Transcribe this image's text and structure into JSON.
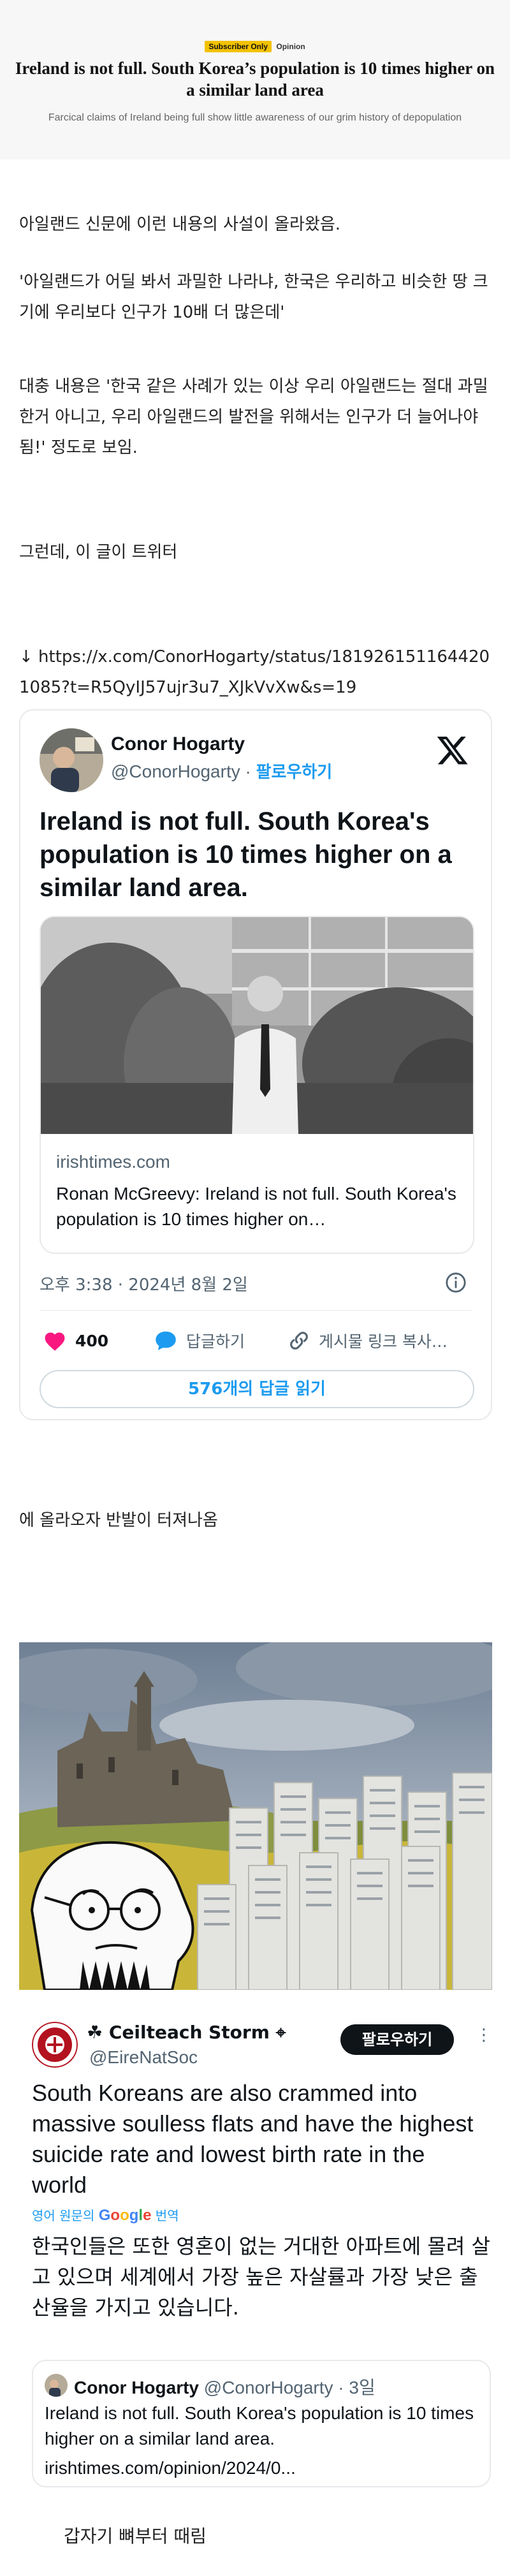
{
  "article": {
    "badge": "Subscriber Only",
    "section": "Opinion",
    "title": "Ireland is not full. South Korea’s population is 10 times higher on a similar land area",
    "subtitle": "Farcical claims of Ireland being full show little awareness of our grim history of depopulation",
    "colors": {
      "badge_bg": "#f2c200",
      "background": "#f7f7f7"
    }
  },
  "body": {
    "p1": "아일랜드 신문에 이런 내용의 사설이 올라왔음.",
    "p2": " '아일랜드가 어딜 봐서 과밀한 나라냐, 한국은 우리하고 비슷한 땅 크기에 우리보다 인구가 10배 더 많은데'",
    "p3": " 대충 내용은 '한국 같은 사례가 있는 이상 우리 아일랜드는 절대 과밀한거 아니고, 우리 아일랜드의 발전을 위해서는 인구가 더 늘어나야 됨!' 정도로 보임.",
    "p4": " 그런데, 이 글이 트위터",
    "url": "↓ https://x.com/ConorHogarty/status/1819261511644201085?t=R5QyIJ57ujr3u7_XJkVvXw&s=19",
    "p5": "에 올라오자 반발이 터져나옴",
    "closing": "갑자기 뼈부터 때림"
  },
  "tweet": {
    "name": "Conor Hogarty",
    "handle": "@ConorHogarty",
    "separator": " · ",
    "follow": "팔로우하기",
    "text": "Ireland is not full. South Korea's population is 10 times higher on a similar land area.",
    "link_domain": "irishtimes.com",
    "link_title": "Ronan McGreevy: Ireland is not full. South Korea's population is 10 times higher on…",
    "timestamp": "오후 3:38 · 2024년 8월 2일",
    "likes": "400",
    "reply_label": "답글하기",
    "copy_link_label": "게시물 링크 복사…",
    "read_replies": "576개의 답글 읽기",
    "icons": {
      "logo": "x-logo-icon",
      "info": "info-icon",
      "like": "heart-icon",
      "reply": "speech-bubble-icon",
      "link": "link-icon"
    },
    "colors": {
      "accent": "#1d9bf0",
      "heart": "#f91880",
      "muted": "#536471"
    }
  },
  "reply": {
    "name": "☘ Ceilteach Storm ⌖",
    "handle": "@EireNatSoc",
    "follow_button": "팔로우하기",
    "more": "⋮",
    "text": "South Koreans are also crammed into massive soulless flats and have the highest suicide rate and lowest birth rate in the world",
    "translate_prefix": "영어 원문의 ",
    "translate_brand": "Google",
    "translate_suffix": " 번역",
    "translated": "한국인들은 또한 영혼이 없는 거대한 아파트에 몰려 살고 있으며 세계에서 가장 높은 자살률과 가장 낮은 출산율을 가지고 있습니다.",
    "quote": {
      "name": "Conor Hogarty",
      "handle": "@ConorHogarty",
      "age": "3일",
      "text": "Ireland is not full. South Korea's population is 10 times higher on a similar land area.",
      "link": "irishtimes.com/opinion/2024/0..."
    }
  }
}
